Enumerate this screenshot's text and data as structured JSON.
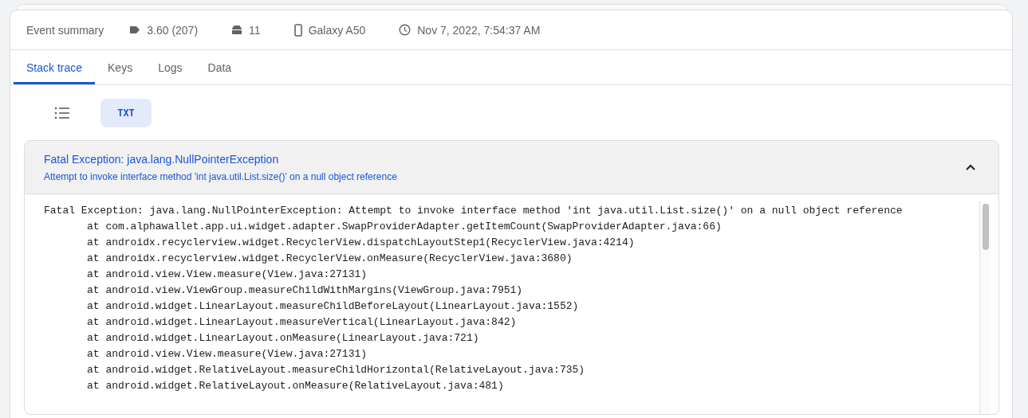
{
  "summary": {
    "title": "Event summary",
    "items": [
      {
        "kind": "version",
        "text": "3.60 (207)"
      },
      {
        "kind": "android",
        "text": "11"
      },
      {
        "kind": "device",
        "text": "Galaxy A50"
      },
      {
        "kind": "time",
        "text": "Nov 7, 2022, 7:54:37 AM"
      }
    ]
  },
  "tabs": [
    {
      "label": "Stack trace",
      "selected": true
    },
    {
      "label": "Keys",
      "selected": false
    },
    {
      "label": "Logs",
      "selected": false
    },
    {
      "label": "Data",
      "selected": false
    }
  ],
  "view_toggle": [
    {
      "kind": "list",
      "selected": false
    },
    {
      "kind": "text",
      "label": "TXT",
      "selected": true
    }
  ],
  "exception": {
    "title": "Fatal Exception: java.lang.NullPointerException",
    "subtitle": "Attempt to invoke interface method 'int java.util.List.size()' on a null object reference",
    "expanded": true,
    "lines": [
      {
        "kind": "head",
        "text": "Fatal Exception: java.lang.NullPointerException: Attempt to invoke interface method 'int java.util.List.size()' on a null object reference"
      },
      {
        "kind": "frame",
        "text": "at com.alphawallet.app.ui.widget.adapter.SwapProviderAdapter.getItemCount(SwapProviderAdapter.java:66)"
      },
      {
        "kind": "frame",
        "text": "at androidx.recyclerview.widget.RecyclerView.dispatchLayoutStep1(RecyclerView.java:4214)"
      },
      {
        "kind": "frame",
        "text": "at androidx.recyclerview.widget.RecyclerView.onMeasure(RecyclerView.java:3680)"
      },
      {
        "kind": "frame",
        "text": "at android.view.View.measure(View.java:27131)"
      },
      {
        "kind": "frame",
        "text": "at android.view.ViewGroup.measureChildWithMargins(ViewGroup.java:7951)"
      },
      {
        "kind": "frame",
        "text": "at android.widget.LinearLayout.measureChildBeforeLayout(LinearLayout.java:1552)"
      },
      {
        "kind": "frame",
        "text": "at android.widget.LinearLayout.measureVertical(LinearLayout.java:842)"
      },
      {
        "kind": "frame",
        "text": "at android.widget.LinearLayout.onMeasure(LinearLayout.java:721)"
      },
      {
        "kind": "frame",
        "text": "at android.view.View.measure(View.java:27131)"
      },
      {
        "kind": "frame",
        "text": "at android.widget.RelativeLayout.measureChildHorizontal(RelativeLayout.java:735)"
      },
      {
        "kind": "frame",
        "text": "at android.widget.RelativeLayout.onMeasure(RelativeLayout.java:481)"
      }
    ]
  }
}
